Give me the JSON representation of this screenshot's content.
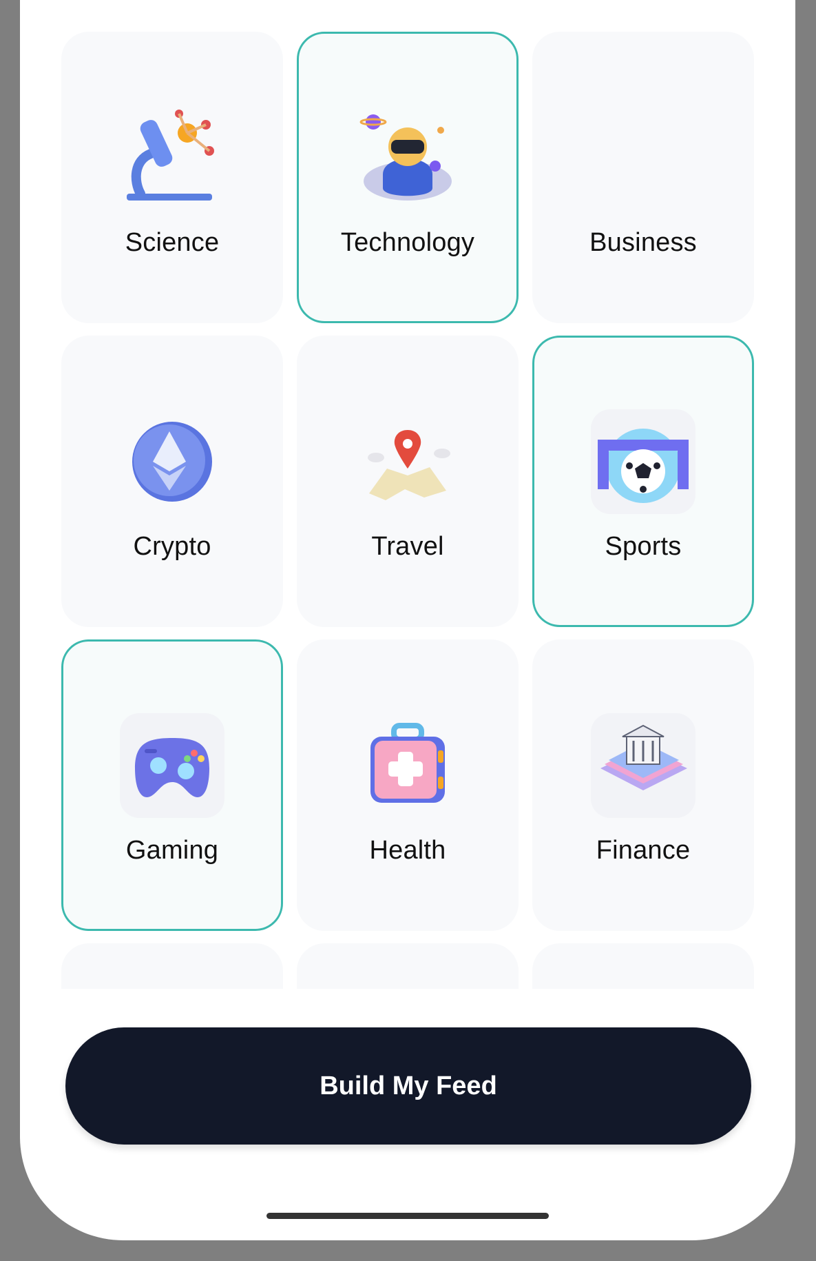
{
  "categories": [
    {
      "label": "Science",
      "icon": "microscope-icon",
      "selected": false
    },
    {
      "label": "Technology",
      "icon": "vr-headset-icon",
      "selected": true
    },
    {
      "label": "Business",
      "icon": "briefcase-icon",
      "selected": false
    },
    {
      "label": "Crypto",
      "icon": "ethereum-coin-icon",
      "selected": false
    },
    {
      "label": "Travel",
      "icon": "map-pin-icon",
      "selected": false
    },
    {
      "label": "Sports",
      "icon": "soccer-goal-icon",
      "selected": true
    },
    {
      "label": "Gaming",
      "icon": "gamepad-icon",
      "selected": true
    },
    {
      "label": "Health",
      "icon": "first-aid-kit-icon",
      "selected": false
    },
    {
      "label": "Finance",
      "icon": "bank-icon",
      "selected": false
    }
  ],
  "actions": {
    "build_feed_label": "Build My Feed"
  },
  "colors": {
    "selected_border": "#3cb9ae",
    "button_bg": "#121829",
    "card_bg": "#f8f9fb"
  }
}
